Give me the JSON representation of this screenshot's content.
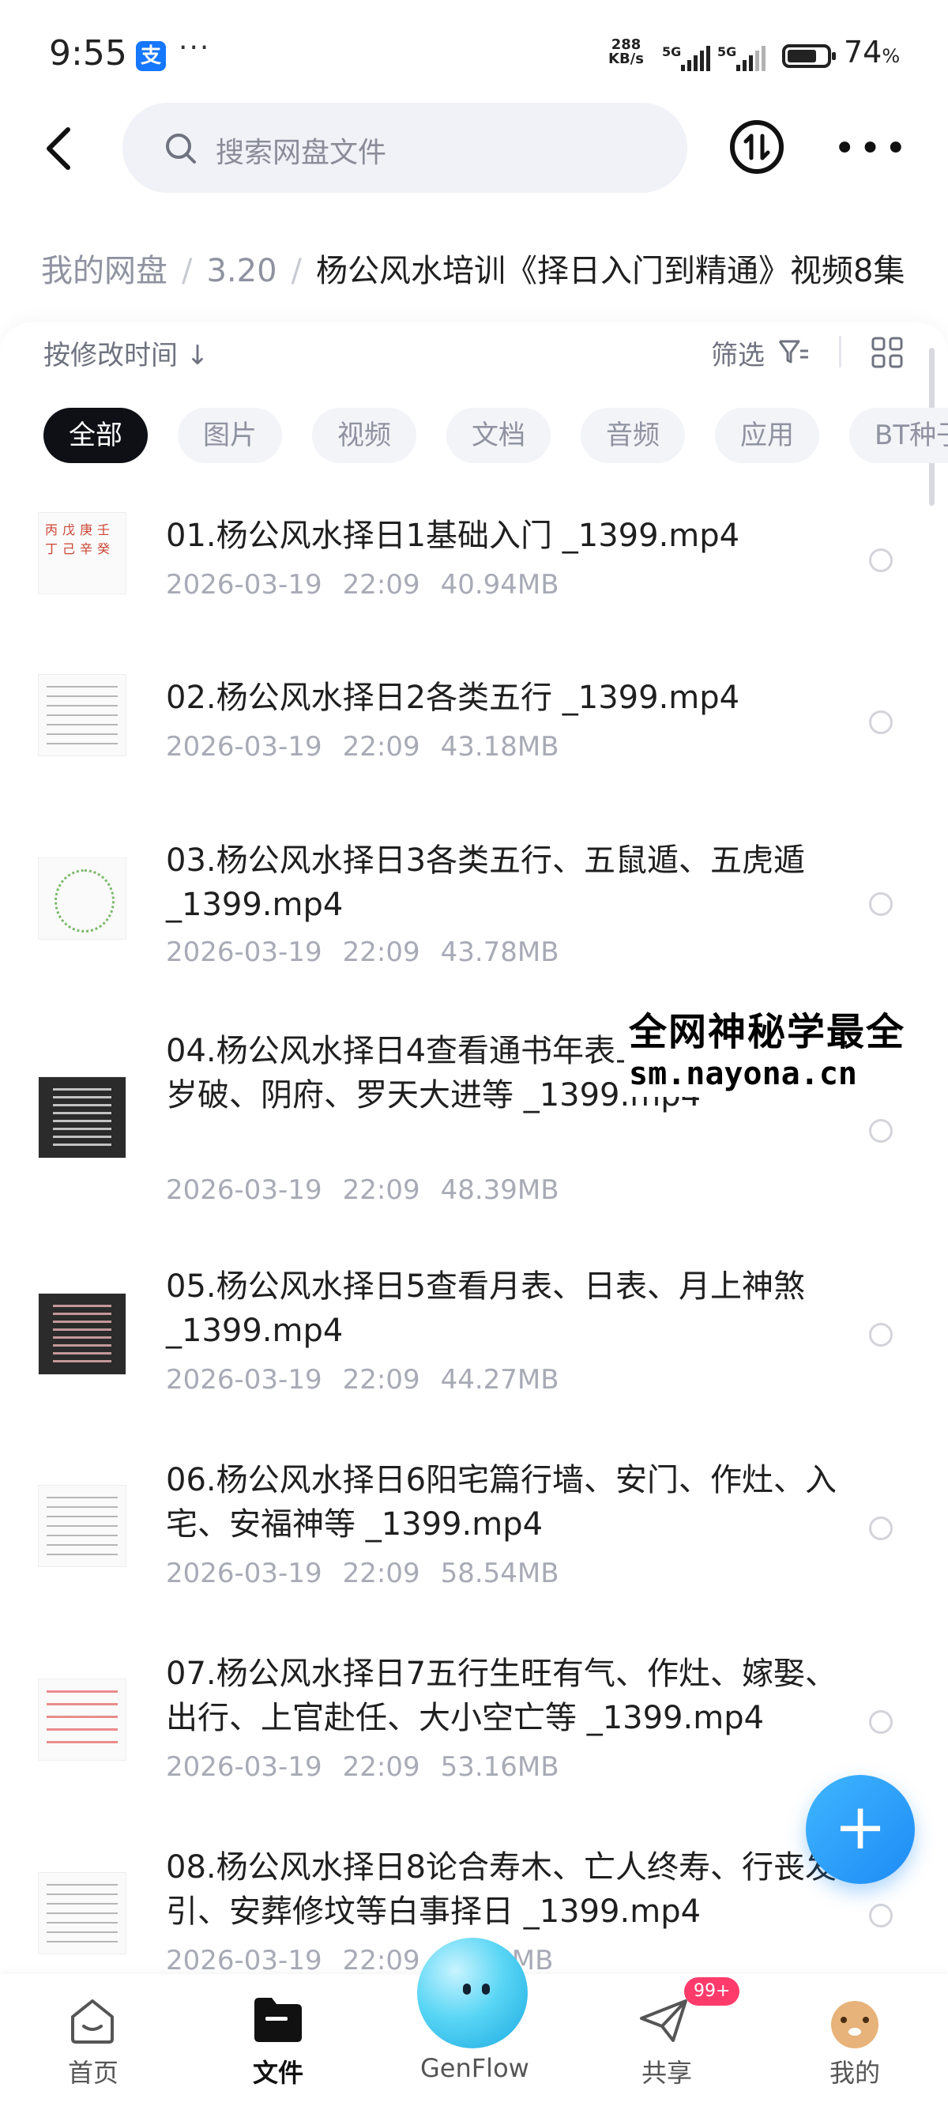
{
  "status_bar": {
    "time": "9:55",
    "app_badge": "支",
    "more": "···",
    "net_speed_value": "288",
    "net_speed_unit": "KB/s",
    "sim1": "5G",
    "sim2": "5G",
    "battery_percent": "74",
    "battery_symbol": "%",
    "battery_level": 0.74
  },
  "header": {
    "search_placeholder": "搜索网盘文件",
    "more": "•••"
  },
  "breadcrumb": {
    "root": "我的网盘",
    "sep": "/",
    "folder": "3.20",
    "current": "杨公风水培训《择日入门到精通》视频8集"
  },
  "toolbar": {
    "sort_label": "按修改时间",
    "sort_arrow": "↓",
    "filter_label": "筛选"
  },
  "chips": [
    {
      "label": "全部",
      "active": true
    },
    {
      "label": "图片"
    },
    {
      "label": "视频"
    },
    {
      "label": "文档"
    },
    {
      "label": "音频"
    },
    {
      "label": "应用"
    },
    {
      "label": "BT种子"
    }
  ],
  "files": [
    {
      "name": "01.杨公风水择日1基础入门 _1399.mp4",
      "date": "2026-03-19",
      "time": "22:09",
      "size": "40.94MB"
    },
    {
      "name": "02.杨公风水择日2各类五行 _1399.mp4",
      "date": "2026-03-19",
      "time": "22:09",
      "size": "43.18MB"
    },
    {
      "name": "03.杨公风水择日3各类五行、五鼠遁、五虎遁 _1399.mp4",
      "date": "2026-03-19",
      "time": "22:09",
      "size": "43.78MB"
    },
    {
      "name": "04.杨公风水择日4查看通书年表上神煞，山煞、岁破、阴府、罗天大进等 _1399.mp4",
      "date": "2026-03-19",
      "time": "22:09",
      "size": "48.39MB"
    },
    {
      "name": "05.杨公风水择日5查看月表、日表、月上神煞 _1399.mp4",
      "date": "2026-03-19",
      "time": "22:09",
      "size": "44.27MB"
    },
    {
      "name": "06.杨公风水择日6阳宅篇行墙、安门、作灶、入宅、安福神等 _1399.mp4",
      "date": "2026-03-19",
      "time": "22:09",
      "size": "58.54MB"
    },
    {
      "name": "07.杨公风水择日7五行生旺有气、作灶、嫁娶、出行、上官赴任、大小空亡等 _1399.mp4",
      "date": "2026-03-19",
      "time": "22:09",
      "size": "53.16MB"
    },
    {
      "name": "08.杨公风水择日8论合寿木、亡人终寿、行丧发引、安葬修坟等白事择日 _1399.mp4",
      "date": "2026-03-19",
      "time": "22:09",
      "size": "47.??MB"
    }
  ],
  "watermark": {
    "line1": "全网神秘学最全",
    "line2": "sm.nayona.cn"
  },
  "fab": {
    "label": "+"
  },
  "bottom_nav": [
    {
      "label": "首页"
    },
    {
      "label": "文件",
      "active": true
    },
    {
      "label": "GenFlow"
    },
    {
      "label": "共享",
      "badge": "99+"
    },
    {
      "label": "我的"
    }
  ],
  "colors": {
    "accent": "#1e8bf5",
    "chip_active": "#0e1016",
    "badge": "#ff3b6b",
    "meta_text": "#a8abb6"
  }
}
